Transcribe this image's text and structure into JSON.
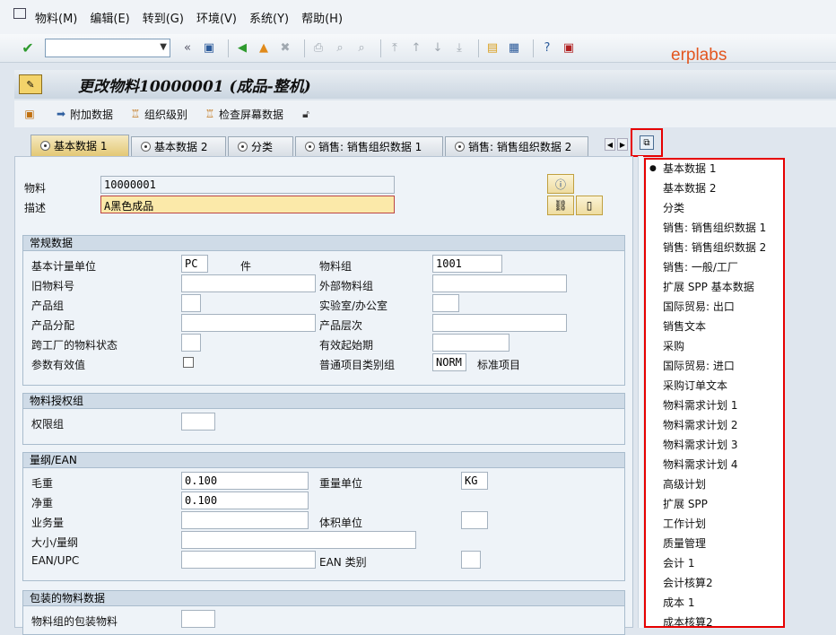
{
  "menu": [
    "物料(M)",
    "编辑(E)",
    "转到(G)",
    "环境(V)",
    "系统(Y)",
    "帮助(H)"
  ],
  "watermark": "erplabs",
  "title": "更改物料10000001 (成品-整机)",
  "app_toolbar": [
    "附加数据",
    "组织级别",
    "检查屏幕数据"
  ],
  "tabs": [
    "基本数据 1",
    "基本数据 2",
    "分类",
    "销售: 销售组织数据 1",
    "销售: 销售组织数据 2"
  ],
  "header": {
    "material_label": "物料",
    "material_value": "10000001",
    "desc_label": "描述",
    "desc_value": "A黑色成品"
  },
  "general": {
    "title": "常规数据",
    "base_uom_label": "基本计量单位",
    "base_uom_value": "PC",
    "base_uom_text": "件",
    "old_mat_label": "旧物料号",
    "prod_group_label": "产品组",
    "prod_alloc_label": "产品分配",
    "cross_plant_label": "跨工厂的物料状态",
    "param_label": "参数有效值",
    "mat_group_label": "物料组",
    "mat_group_value": "1001",
    "ext_group_label": "外部物料组",
    "lab_label": "实验室/办公室",
    "hierarchy_label": "产品层次",
    "valid_from_label": "有效起始期",
    "item_cat_label": "普通项目类别组",
    "item_cat_value": "NORM",
    "item_cat_text": "标准项目"
  },
  "auth": {
    "title": "物料授权组",
    "auth_label": "权限组"
  },
  "dims": {
    "title": "量纲/EAN",
    "gross_label": "毛重",
    "gross_value": "0.100",
    "net_label": "净重",
    "net_value": "0.100",
    "volume_label": "业务量",
    "size_label": "大小/量纲",
    "ean_label": "EAN/UPC",
    "weight_unit_label": "重量单位",
    "weight_unit_value": "KG",
    "vol_unit_label": "体积单位",
    "ean_cat_label": "EAN 类别"
  },
  "packaging": {
    "title": "包装的物料数据",
    "pack_label": "物料组的包装物料"
  },
  "tab_list": [
    "基本数据 1",
    "基本数据 2",
    "分类",
    "销售: 销售组织数据 1",
    "销售: 销售组织数据 2",
    "销售: 一般/工厂",
    "扩展 SPP 基本数据",
    "国际贸易: 出口",
    "销售文本",
    "采购",
    "国际贸易: 进口",
    "采购订单文本",
    "物料需求计划 1",
    "物料需求计划 2",
    "物料需求计划 3",
    "物料需求计划 4",
    "高级计划",
    "扩展 SPP",
    "工作计划",
    "质量管理",
    "会计 1",
    "会计核算2",
    "成本 1",
    "成本核算2"
  ]
}
